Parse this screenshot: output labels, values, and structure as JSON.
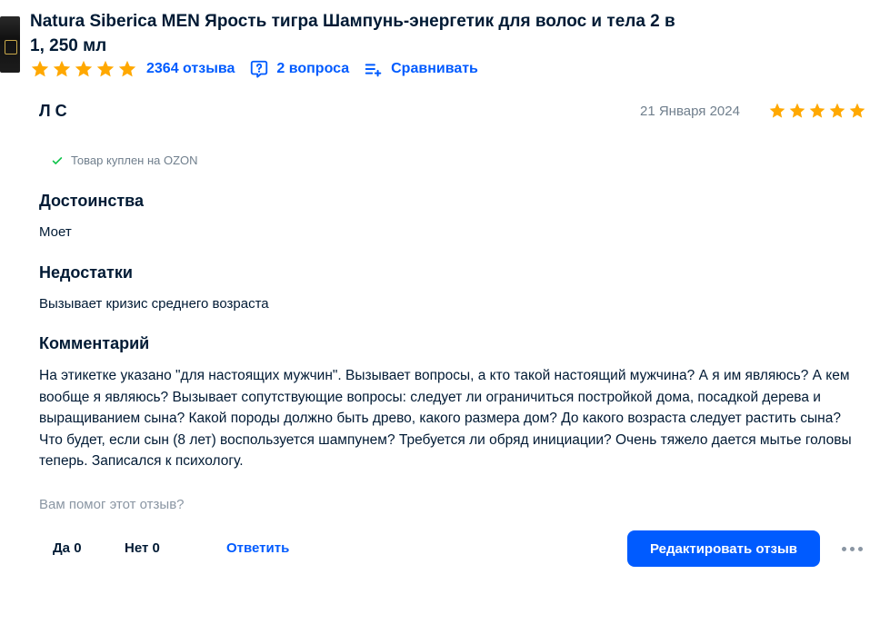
{
  "product": {
    "title": "Natura Siberica MEN Ярость тигра Шампунь-энергетик для волос и тела 2 в 1, 250 мл",
    "rating_stars": 5,
    "reviews_link": "2364 отзыва",
    "questions_link": "2 вопроса",
    "compare_link": "Сравнивать",
    "icons": {
      "star": "star-icon",
      "questions": "question-bubble-icon",
      "compare": "compare-list-icon"
    }
  },
  "review": {
    "author": "Л С",
    "date": "21 Января 2024",
    "rating_stars": 5,
    "purchased_note": "Товар куплен на OZON",
    "pros_heading": "Достоинства",
    "pros_text": "Моет",
    "cons_heading": "Недостатки",
    "cons_text": "Вызывает кризис среднего возраста",
    "comment_heading": "Комментарий",
    "comment_text": "На этикетке указано \"для настоящих мужчин\". Вызывает вопросы, а кто такой настоящий мужчина? А я им являюсь? А кем вообще я являюсь? Вызывает сопутствующие вопросы: следует ли ограничиться постройкой дома, посадкой дерева и выращиванием сына? Какой породы должно быть древо, какого размера дом? До какого возраста следует растить сына? Что будет, если сын (8 лет) воспользуется шампунем? Требуется ли обряд инициации? Очень тяжело дается мытье головы теперь. Записался к психологу."
  },
  "footer": {
    "helpful_question": "Вам помог этот отзыв?",
    "yes_label": "Да 0",
    "no_label": "Нет 0",
    "reply_label": "Ответить",
    "edit_label": "Редактировать отзыв"
  },
  "colors": {
    "accent": "#005bff",
    "star": "#ffa800",
    "check": "#10c44c",
    "muted": "#707f8d"
  }
}
